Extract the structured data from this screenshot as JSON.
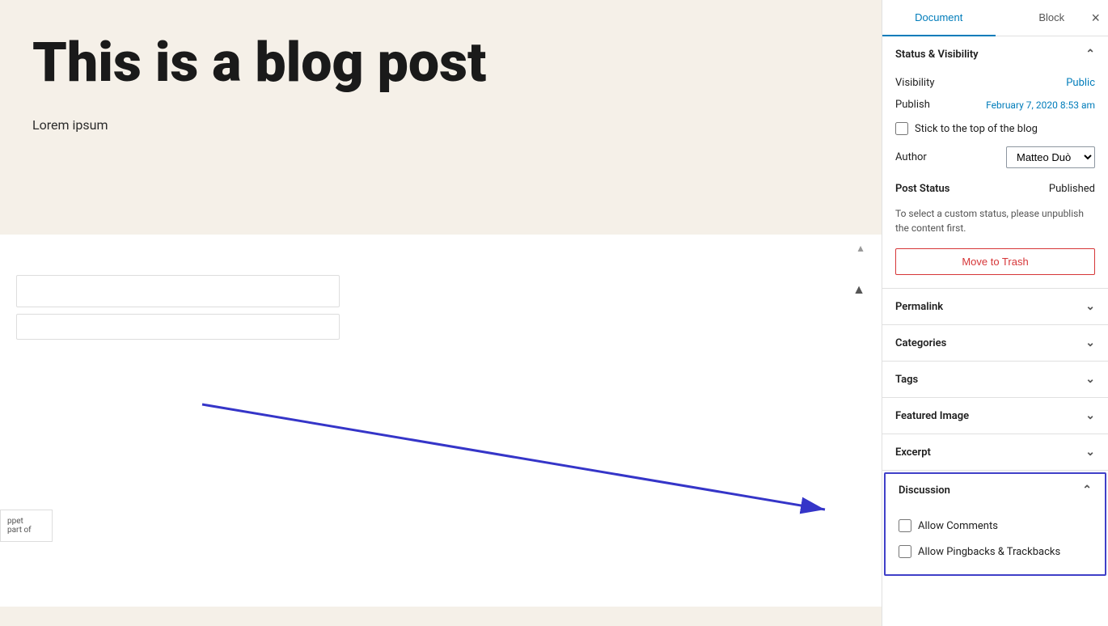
{
  "tabs": {
    "document": "Document",
    "block": "Block"
  },
  "close_icon": "×",
  "sidebar": {
    "status_visibility": {
      "label": "Status & Visibility",
      "visibility_label": "Visibility",
      "visibility_value": "Public",
      "publish_label": "Publish",
      "publish_value": "February 7, 2020 8:53 am",
      "stick_to_top_label": "Stick to the top of the blog",
      "author_label": "Author",
      "author_value": "Matteo Duò",
      "post_status_label": "Post Status",
      "post_status_value": "Published",
      "custom_status_note": "To select a custom status, please unpublish the content first.",
      "move_to_trash": "Move to Trash"
    },
    "permalink": {
      "label": "Permalink"
    },
    "categories": {
      "label": "Categories"
    },
    "tags": {
      "label": "Tags"
    },
    "featured_image": {
      "label": "Featured Image"
    },
    "excerpt": {
      "label": "Excerpt"
    },
    "discussion": {
      "label": "Discussion",
      "allow_comments_label": "Allow Comments",
      "allow_pingbacks_label": "Allow Pingbacks & Trackbacks"
    }
  },
  "content": {
    "title": "This is a blog post",
    "lorem": "Lorem ipsum",
    "snippet_line1": "ppet",
    "snippet_line2": "part of"
  }
}
